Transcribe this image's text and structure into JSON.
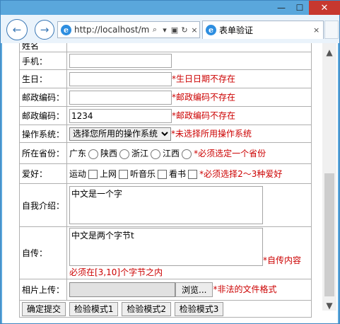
{
  "window": {
    "minimize": "—",
    "maximize": "☐",
    "close": "✕"
  },
  "toolbar": {
    "back_icon": "arrow-left",
    "forward_icon": "arrow-right",
    "address": "http://localhost/m",
    "address_icons": [
      "search",
      "dropdown",
      "compat",
      "refresh",
      "close"
    ],
    "tab_title": "表单验证",
    "tab_close": "×"
  },
  "form": {
    "top_partial_label": "姓名",
    "phone": {
      "label": "手机：",
      "value": ""
    },
    "birthday": {
      "label": "生日：",
      "value": "",
      "error": "*生日日期不存在"
    },
    "zip1": {
      "label": "邮政编码：",
      "value": "",
      "error": "*邮政编码不存在"
    },
    "zip2": {
      "label": "邮政编码：",
      "value": "1234",
      "error": "*邮政编码不存在"
    },
    "os": {
      "label": "操作系统：",
      "selected": "选择您所用的操作系统",
      "error": "*未选择所用操作系统"
    },
    "province": {
      "label": "所在省份：",
      "options": [
        "广东",
        "陕西",
        "浙江",
        "江西"
      ],
      "error": "*必须选定一个省份"
    },
    "hobby": {
      "label": "爱好：",
      "options": [
        "运动",
        "上网",
        "听音乐",
        "看书"
      ],
      "error": "*必须选择2～3种爱好"
    },
    "intro": {
      "label": "自我介绍：",
      "value": "中文是一个字"
    },
    "bio": {
      "label": "自传：",
      "value": "中文是两个字节t",
      "error_inline": "*自传内容",
      "error_line2": "必须在[3,10]个字节之内"
    },
    "photo": {
      "label": "相片上传：",
      "browse_label": "浏览...",
      "error": "*非法的文件格式"
    },
    "buttons": [
      "确定提交",
      "检验模式1",
      "检验模式2",
      "检验模式3"
    ]
  },
  "scrollbar": {
    "up": "▲",
    "down": "▼"
  },
  "colors": {
    "error": "#cc0000",
    "chrome": "#5aa7dc",
    "close": "#c7382f"
  }
}
